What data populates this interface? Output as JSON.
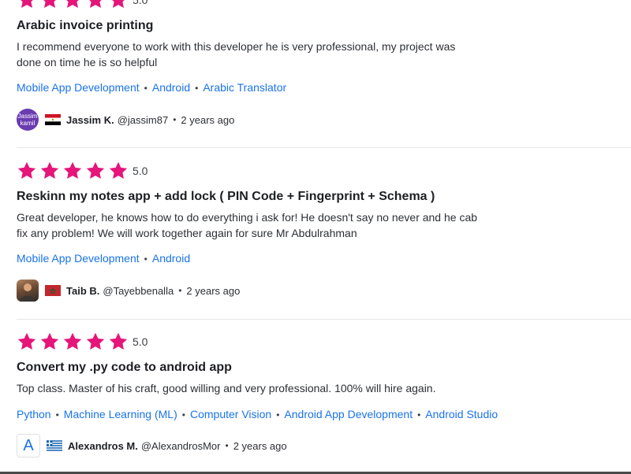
{
  "colors": {
    "star": "#e5157a",
    "link": "#1a73e8"
  },
  "reviews": [
    {
      "rating": 5,
      "score": "5.0",
      "title": "Arabic invoice printing",
      "body": "I recommend everyone to work with this developer he is very professional, my project was done on time he is so helpful",
      "tags": [
        "Mobile App Development",
        "Android",
        "Arabic Translator"
      ],
      "author": {
        "avatar_type": "text",
        "avatar_line1": "Jassim",
        "avatar_line2": "kamil",
        "flag": "egypt-flag-icon",
        "name": "Jassim K.",
        "handle": "@jassim87",
        "time": "2 years ago"
      }
    },
    {
      "rating": 5,
      "score": "5.0",
      "title": "Reskinn my notes app + add lock ( PIN Code + Fingerprint + Schema )",
      "body": "Great developer, he knows how to do everything i ask for! He doesn't say no never and he cab fix any problem! We will work together again for sure Mr Abdulrahman",
      "tags": [
        "Mobile App Development",
        "Android"
      ],
      "author": {
        "avatar_type": "photo",
        "flag": "morocco-flag-icon",
        "name": "Taib B.",
        "handle": "@Tayebbenalla",
        "time": "2 years ago"
      }
    },
    {
      "rating": 5,
      "score": "5.0",
      "title": "Convert my .py code to android app",
      "body": "Top class. Master of his craft, good willing and very professional. 100% will hire again.",
      "tags": [
        "Python",
        "Machine Learning (ML)",
        "Computer Vision",
        "Android App Development",
        "Android Studio"
      ],
      "author": {
        "avatar_type": "letter",
        "avatar_letter": "A",
        "flag": "greece-flag-icon",
        "name": "Alexandros M.",
        "handle": "@AlexandrosMor",
        "time": "2 years ago"
      }
    }
  ]
}
